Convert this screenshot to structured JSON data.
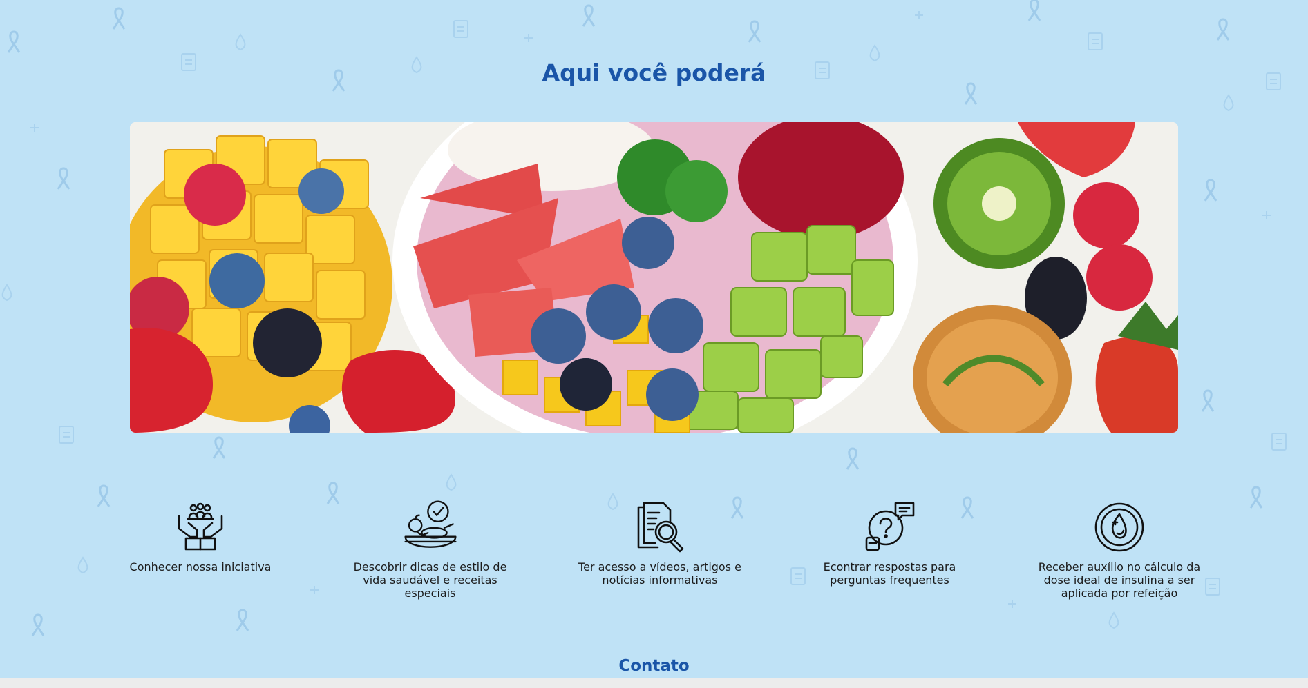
{
  "section": {
    "title": "Aqui você poderá"
  },
  "hero": {
    "alt": "fruit-bowl-photo"
  },
  "features": [
    {
      "icon": "hands-community-icon",
      "label": "Conhecer nossa iniciativa"
    },
    {
      "icon": "healthy-food-plate-icon",
      "label": "Descobrir dicas de estilo de vida saudável e receitas especiais"
    },
    {
      "icon": "document-search-icon",
      "label": "Ter acesso a vídeos, artigos e notícias informativas"
    },
    {
      "icon": "question-chat-icon",
      "label": "Econtrar respostas para perguntas frequentes"
    },
    {
      "icon": "insulin-drop-icon",
      "label": "Receber auxílio no cálculo da dose ideal de insulina a ser aplicada por refeição"
    }
  ],
  "footer": {
    "contact": "Contato"
  },
  "colors": {
    "background": "#bfe2f6",
    "accent": "#1a55a8",
    "text": "#1b1b1b"
  }
}
